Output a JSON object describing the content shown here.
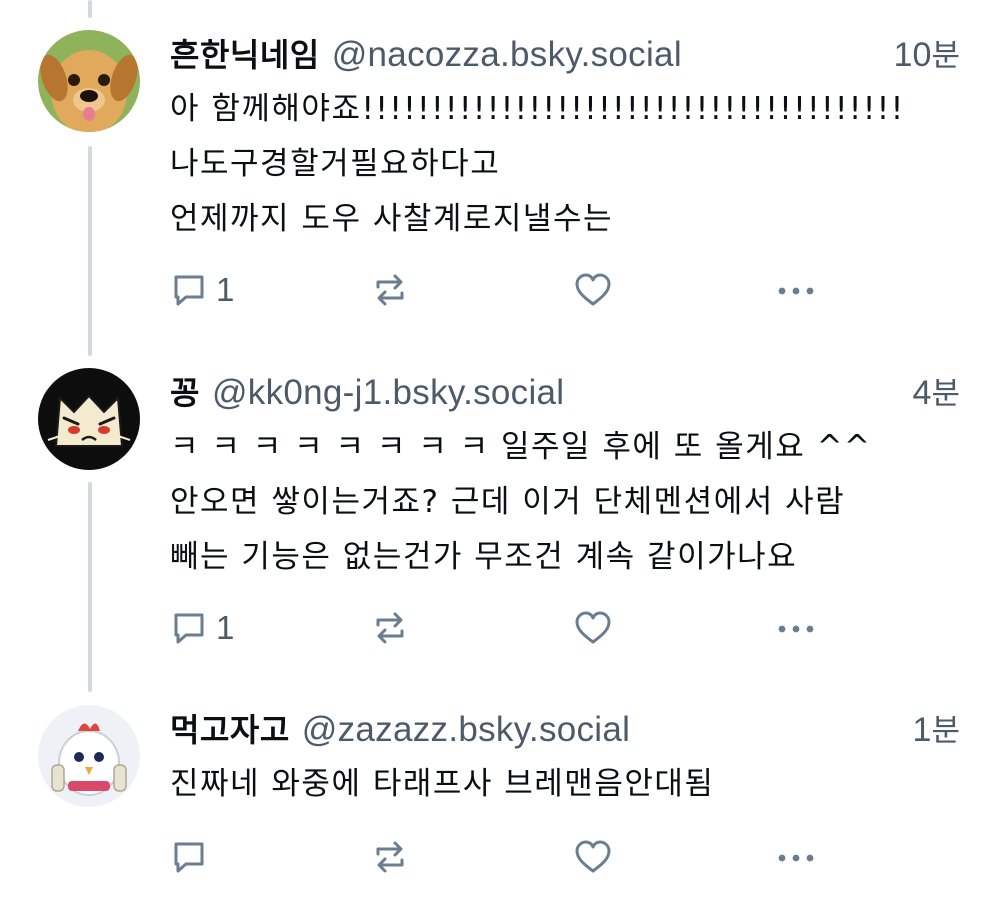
{
  "thread": {
    "posts": [
      {
        "display_name": "흔한닉네임",
        "handle": "@nacozza.bsky.social",
        "time_value": "10",
        "time_unit": "분",
        "avatar_icon": "puppy-avatar",
        "lines": [
          "아 함께해야죠!!!!!!!!!!!!!!!!!!!!!!!!!!!!!!!!!!!!!!!",
          "나도구경할거필요하다고",
          "언제까지 도우 사찰계로지낼수는"
        ],
        "reply_count": "1",
        "repost_count": "",
        "like_count": ""
      },
      {
        "display_name": "꽁",
        "handle": "@kk0ng-j1.bsky.social",
        "time_value": "4",
        "time_unit": "분",
        "avatar_icon": "cartoon-cat-avatar",
        "lines": [
          "ㅋ ㅋ ㅋ ㅋ ㅋ ㅋ ㅋ ㅋ 일주일 후에 또 올게요 ^^",
          "안오면 쌓이는거죠? 근데 이거 단체멘션에서 사람",
          "빼는 기능은 없는건가 무조건 계속 같이가나요"
        ],
        "reply_count": "1",
        "repost_count": "",
        "like_count": ""
      },
      {
        "display_name": "먹고자고",
        "handle": "@zazazz.bsky.social",
        "time_value": "1",
        "time_unit": "분",
        "avatar_icon": "chicken-mascot-avatar",
        "lines": [
          "진짜네 와중에 타래프사 브레맨음안대됨"
        ],
        "reply_count": "",
        "repost_count": "",
        "like_count": ""
      }
    ]
  },
  "icons": {
    "reply": "reply-icon",
    "repost": "repost-icon",
    "like": "heart-icon",
    "more": "more-options-icon"
  },
  "colors": {
    "text_primary": "#0b0f14",
    "text_secondary": "#4c5a69",
    "thread_line": "#d3d9df",
    "icon": "#6b7d90"
  }
}
